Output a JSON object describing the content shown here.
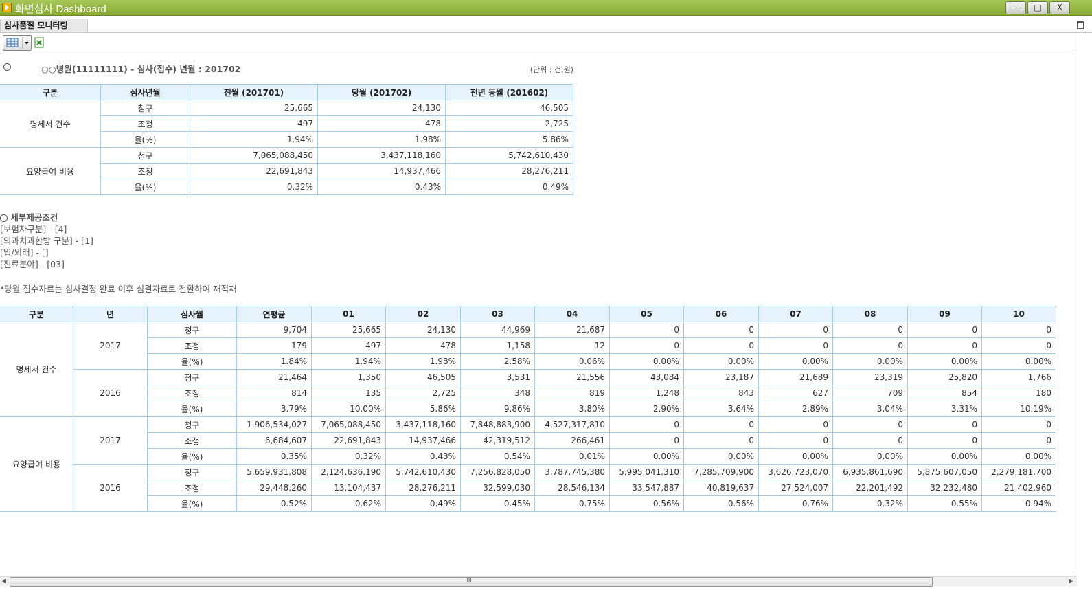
{
  "window": {
    "title": "화면심사 Dashboard",
    "btn_min": "–",
    "btn_max": "□",
    "btn_close": "X"
  },
  "tab": {
    "label": "심사품질 모니터링"
  },
  "info": {
    "hospital_line": "○○병원(11111111) - 심사(접수) 년월 :  201702",
    "unit": "(단위 : 건,원)"
  },
  "summary": {
    "headers": [
      "구분",
      "심사년월",
      "전월 (201701)",
      "당월 (201702)",
      "전년 동월 (201602)"
    ],
    "groups": [
      {
        "label": "명세서 건수",
        "rows": [
          {
            "label": "청구",
            "values": [
              "25,665",
              "24,130",
              "46,505"
            ]
          },
          {
            "label": "조정",
            "values": [
              "497",
              "478",
              "2,725"
            ]
          },
          {
            "label": "율(%)",
            "values": [
              "1.94%",
              "1.98%",
              "5.86%"
            ]
          }
        ]
      },
      {
        "label": "요양급여 비용",
        "rows": [
          {
            "label": "청구",
            "values": [
              "7,065,088,450",
              "3,437,118,160",
              "5,742,610,430"
            ]
          },
          {
            "label": "조정",
            "values": [
              "22,691,843",
              "14,937,466",
              "28,276,211"
            ]
          },
          {
            "label": "율(%)",
            "values": [
              "0.32%",
              "0.43%",
              "0.49%"
            ]
          }
        ]
      }
    ]
  },
  "conditions": {
    "title": "세부제공조건",
    "items": [
      "[보험자구분] - [4]",
      "[의과치과한방 구분] - [1]",
      "[입/외래] - []",
      "[진료분야] - [03]"
    ]
  },
  "note": "*당월 접수자료는 심사결정 완료 이후 심결자료로 전환하여 재적재",
  "detail": {
    "headers": [
      "구분",
      "년",
      "심사월",
      "연평균",
      "01",
      "02",
      "03",
      "04",
      "05",
      "06",
      "07",
      "08",
      "09",
      "10"
    ],
    "groups": [
      {
        "label": "명세서 건수",
        "years": [
          {
            "year": "2017",
            "rows": [
              {
                "label": "청구",
                "values": [
                  "9,704",
                  "25,665",
                  "24,130",
                  "44,969",
                  "21,687",
                  "0",
                  "0",
                  "0",
                  "0",
                  "0",
                  "0"
                ]
              },
              {
                "label": "조정",
                "values": [
                  "179",
                  "497",
                  "478",
                  "1,158",
                  "12",
                  "0",
                  "0",
                  "0",
                  "0",
                  "0",
                  "0"
                ]
              },
              {
                "label": "율(%)",
                "values": [
                  "1.84%",
                  "1.94%",
                  "1.98%",
                  "2.58%",
                  "0.06%",
                  "0.00%",
                  "0.00%",
                  "0.00%",
                  "0.00%",
                  "0.00%",
                  "0.00%"
                ]
              }
            ]
          },
          {
            "year": "2016",
            "rows": [
              {
                "label": "청구",
                "values": [
                  "21,464",
                  "1,350",
                  "46,505",
                  "3,531",
                  "21,556",
                  "43,084",
                  "23,187",
                  "21,689",
                  "23,319",
                  "25,820",
                  "1,766"
                ]
              },
              {
                "label": "조정",
                "values": [
                  "814",
                  "135",
                  "2,725",
                  "348",
                  "819",
                  "1,248",
                  "843",
                  "627",
                  "709",
                  "854",
                  "180"
                ]
              },
              {
                "label": "율(%)",
                "values": [
                  "3.79%",
                  "10.00%",
                  "5.86%",
                  "9.86%",
                  "3.80%",
                  "2.90%",
                  "3.64%",
                  "2.89%",
                  "3.04%",
                  "3.31%",
                  "10.19%"
                ]
              }
            ]
          }
        ]
      },
      {
        "label": "요양급여 비용",
        "years": [
          {
            "year": "2017",
            "rows": [
              {
                "label": "청구",
                "values": [
                  "1,906,534,027",
                  "7,065,088,450",
                  "3,437,118,160",
                  "7,848,883,900",
                  "4,527,317,810",
                  "0",
                  "0",
                  "0",
                  "0",
                  "0",
                  "0"
                ]
              },
              {
                "label": "조정",
                "values": [
                  "6,684,607",
                  "22,691,843",
                  "14,937,466",
                  "42,319,512",
                  "266,461",
                  "0",
                  "0",
                  "0",
                  "0",
                  "0",
                  "0"
                ]
              },
              {
                "label": "율(%)",
                "values": [
                  "0.35%",
                  "0.32%",
                  "0.43%",
                  "0.54%",
                  "0.01%",
                  "0.00%",
                  "0.00%",
                  "0.00%",
                  "0.00%",
                  "0.00%",
                  "0.00%"
                ]
              }
            ]
          },
          {
            "year": "2016",
            "rows": [
              {
                "label": "청구",
                "values": [
                  "5,659,931,808",
                  "2,124,636,190",
                  "5,742,610,430",
                  "7,256,828,050",
                  "3,787,745,380",
                  "5,995,041,310",
                  "7,285,709,900",
                  "3,626,723,070",
                  "6,935,861,690",
                  "5,875,607,050",
                  "2,279,181,700"
                ]
              },
              {
                "label": "조정",
                "values": [
                  "29,448,260",
                  "13,104,437",
                  "28,276,211",
                  "32,599,030",
                  "28,546,134",
                  "33,547,887",
                  "40,819,637",
                  "27,524,007",
                  "22,201,492",
                  "32,232,480",
                  "21,402,960"
                ]
              },
              {
                "label": "율(%)",
                "values": [
                  "0.52%",
                  "0.62%",
                  "0.49%",
                  "0.45%",
                  "0.75%",
                  "0.56%",
                  "0.56%",
                  "0.76%",
                  "0.32%",
                  "0.55%",
                  "0.94%"
                ]
              }
            ]
          }
        ]
      }
    ]
  },
  "scrollbar": {
    "grip": "III",
    "left_arrow": "◀",
    "right_arrow": "▶"
  }
}
